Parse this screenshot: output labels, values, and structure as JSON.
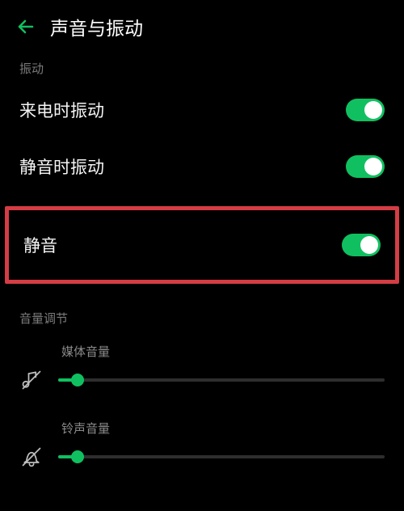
{
  "header": {
    "title": "声音与振动"
  },
  "sections": {
    "vibration_label": "振动",
    "volume_label": "音量调节"
  },
  "toggles": {
    "incoming_call_vibrate": {
      "label": "来电时振动",
      "on": true
    },
    "silent_vibrate": {
      "label": "静音时振动",
      "on": true
    },
    "silent_mode": {
      "label": "静音",
      "on": true
    }
  },
  "sliders": {
    "media": {
      "label": "媒体音量",
      "value_pct": 6
    },
    "ringtone": {
      "label": "铃声音量",
      "value_pct": 6
    }
  }
}
